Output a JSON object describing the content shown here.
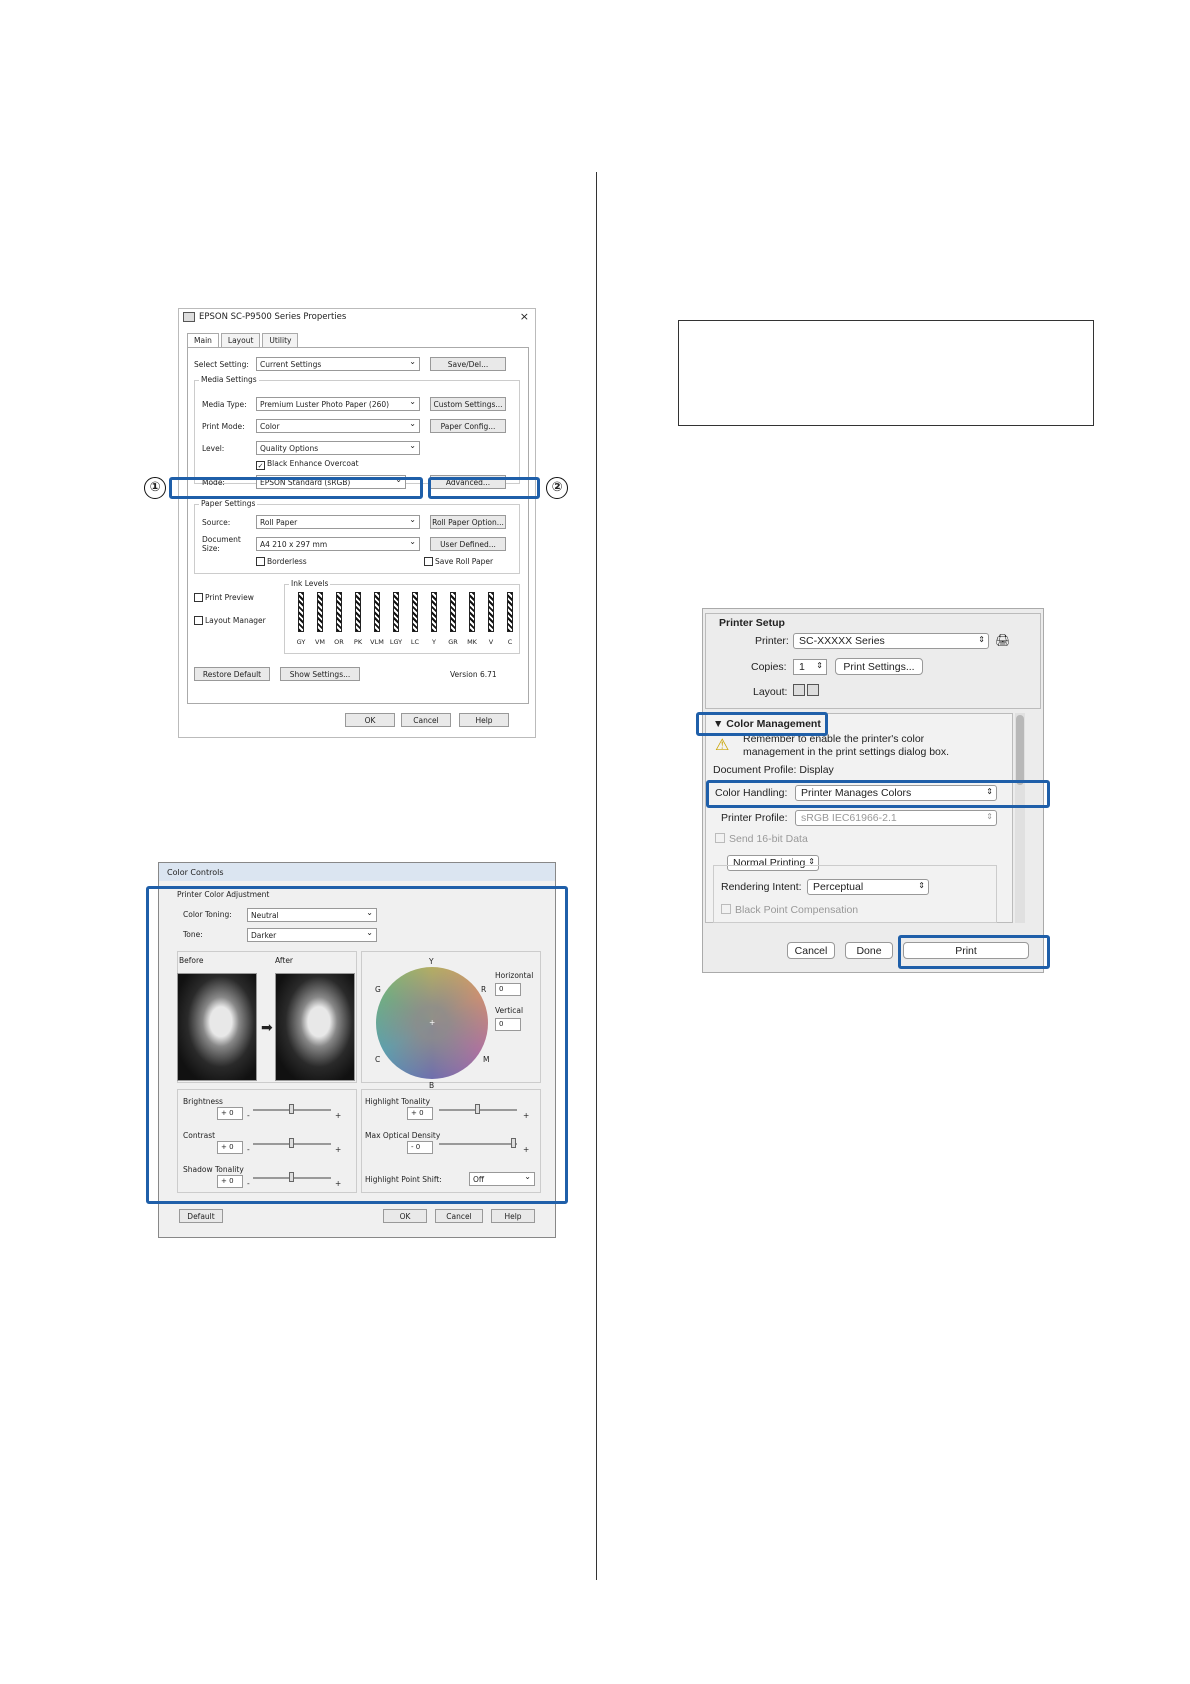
{
  "win_dialog": {
    "title": "EPSON SC-P9500 Series Properties",
    "close_glyph": "×",
    "tabs": [
      "Main",
      "Layout",
      "Utility"
    ],
    "select_setting_label": "Select Setting:",
    "select_setting_value": "Current Settings",
    "save_del_button": "Save/Del...",
    "media_settings_title": "Media Settings",
    "media_type_label": "Media Type:",
    "media_type_value": "Premium Luster Photo Paper (260)",
    "custom_settings_button": "Custom Settings...",
    "print_mode_label": "Print Mode:",
    "print_mode_value": "Color",
    "paper_config_button": "Paper Config...",
    "level_label": "Level:",
    "level_value": "Quality Options",
    "black_enhance_label": "Black Enhance Overcoat",
    "mode_label": "Mode:",
    "mode_value": "EPSON Standard (sRGB)",
    "advanced_button": "Advanced...",
    "paper_settings_title": "Paper Settings",
    "source_label": "Source:",
    "source_value": "Roll Paper",
    "roll_paper_option_button": "Roll Paper Option...",
    "document_size_label": "Document Size:",
    "document_size_value": "A4 210 x 297 mm",
    "user_defined_button": "User Defined...",
    "borderless_label": "Borderless",
    "save_roll_paper_label": "Save Roll Paper",
    "print_preview_label": "Print Preview",
    "layout_manager_label": "Layout Manager",
    "ink_levels_title": "Ink Levels",
    "ink_labels": [
      "GY",
      "VM",
      "OR",
      "PK",
      "VLM",
      "LGY",
      "LC",
      "Y",
      "GR",
      "MK",
      "V",
      "C"
    ],
    "restore_default_button": "Restore Default",
    "show_settings_button": "Show Settings...",
    "version": "Version 6.71",
    "ok_button": "OK",
    "cancel_button": "Cancel",
    "help_button": "Help",
    "callout_1": "①",
    "callout_2": "②"
  },
  "color_controls": {
    "title": "Color Controls",
    "group_title": "Printer Color Adjustment",
    "color_toning_label": "Color Toning:",
    "color_toning_value": "Neutral",
    "tone_label": "Tone:",
    "tone_value": "Darker",
    "before_label": "Before",
    "after_label": "After",
    "arrow_glyph": "➡",
    "wheel_labels": {
      "y": "Y",
      "r": "R",
      "m": "M",
      "b": "B",
      "c": "C",
      "g": "G",
      "center": "+"
    },
    "horizontal_label": "Horizontal",
    "horizontal_value": "0",
    "vertical_label": "Vertical",
    "vertical_value": "0",
    "brightness_label": "Brightness",
    "brightness_value": "+ 0",
    "contrast_label": "Contrast",
    "contrast_value": "+ 0",
    "shadow_tonality_label": "Shadow Tonality",
    "shadow_tonality_value": "+ 0",
    "highlight_tonality_label": "Highlight Tonality",
    "highlight_tonality_value": "+ 0",
    "max_optical_density_label": "Max Optical Density",
    "max_optical_density_value": "- 0",
    "highlight_point_shift_label": "Highlight Point Shift:",
    "highlight_point_shift_value": "Off",
    "minus": "-",
    "plus": "+",
    "default_button": "Default",
    "ok_button": "OK",
    "cancel_button": "Cancel",
    "help_button": "Help"
  },
  "mac_dialog": {
    "printer_setup_title": "Printer Setup",
    "printer_label": "Printer:",
    "printer_value": "SC-XXXXX Series",
    "copies_label": "Copies:",
    "copies_value": "1",
    "print_settings_button": "Print Settings...",
    "layout_label": "Layout:",
    "color_management_title": "▼ Color Management",
    "warning_line1": "Remember to enable the printer's color",
    "warning_line2": "management in the print settings dialog box.",
    "document_profile": "Document Profile: Display",
    "color_handling_label": "Color Handling:",
    "color_handling_value": "Printer Manages Colors",
    "printer_profile_label": "Printer Profile:",
    "printer_profile_value": "sRGB IEC61966-2.1",
    "send_16bit_label": "Send 16-bit Data",
    "normal_printing_value": "Normal Printing",
    "rendering_intent_label": "Rendering Intent:",
    "rendering_intent_value": "Perceptual",
    "black_point_label": "Black Point Compensation",
    "cancel_button": "Cancel",
    "done_button": "Done",
    "print_button": "Print"
  }
}
